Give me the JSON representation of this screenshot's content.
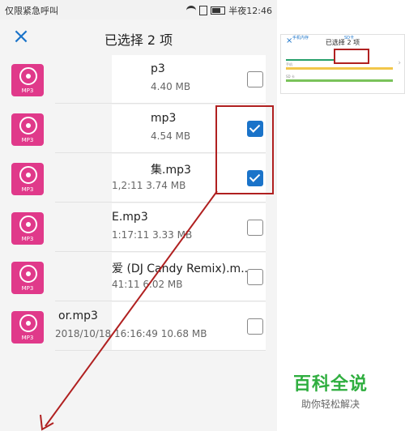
{
  "status_bar": {
    "carrier": "仅限紧急呼叫",
    "time": "半夜12:46"
  },
  "header": {
    "title": "已选择 2 项",
    "close_icon": "close-icon"
  },
  "files": [
    {
      "name": "p3",
      "meta": "4.40 MB",
      "checked": false
    },
    {
      "name": "mp3",
      "meta": "4.54 MB",
      "checked": true
    },
    {
      "name": "集.mp3",
      "meta": "1,2:11 3.74 MB",
      "checked": true
    },
    {
      "name": "E.mp3",
      "meta": "1:17:11 3.33 MB",
      "checked": false
    },
    {
      "name": "爱 (DJ Candy Remix).m...",
      "meta": "41:11 6.02 MB",
      "checked": false
    },
    {
      "name": "or.mp3",
      "meta": "2018/10/18 16:16:49 10.68 MB",
      "checked": false
    }
  ],
  "icon_label": "MP3",
  "thumbnail": {
    "title": "已选择 2 项",
    "tab1": "手机内存",
    "tab2": "SD卡",
    "row1": "手机",
    "row2": "SD 卡"
  },
  "brand": {
    "name": "百科全说",
    "tagline": "助你轻松解决"
  },
  "colors": {
    "accent": "#1a73c9",
    "icon_bg": "#e0398a",
    "annotation": "#b02020",
    "brand": "#2fae3f"
  }
}
